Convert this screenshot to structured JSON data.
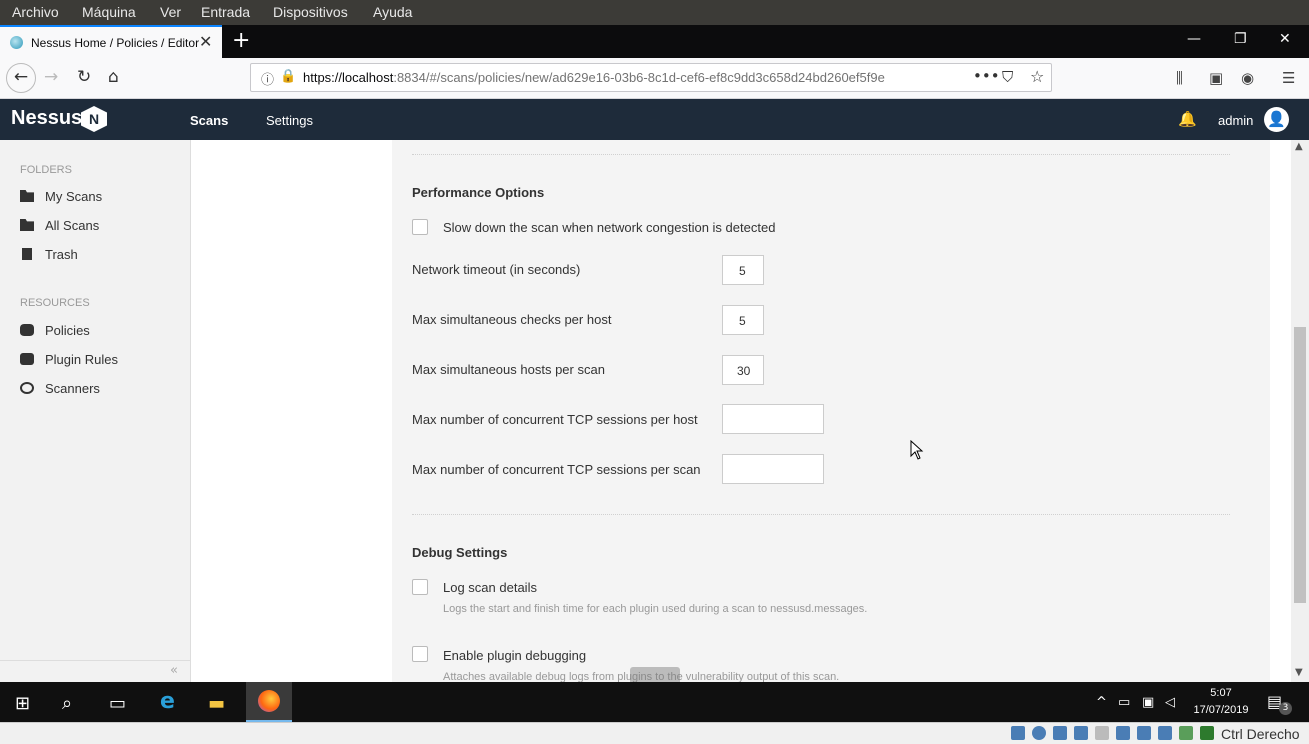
{
  "vb_menu": [
    "Archivo",
    "Máquina",
    "Ver",
    "Entrada",
    "Dispositivos",
    "Ayuda"
  ],
  "browser": {
    "tab_title": "Nessus Home / Policies / Editor",
    "url_host": "https://localhost",
    "url_rest": ":8834/#/scans/policies/new/ad629e16-03b6-8c1d-cef6-ef8c9dd3c658d24bd260ef5f9e"
  },
  "nessus": {
    "logo": "Nessus",
    "logo_badge": "N",
    "tabs": [
      "Scans",
      "Settings"
    ],
    "user": "admin"
  },
  "sidebar": {
    "folders_heading": "FOLDERS",
    "folders": [
      "My Scans",
      "All Scans",
      "Trash"
    ],
    "resources_heading": "RESOURCES",
    "resources": [
      "Policies",
      "Plugin Rules",
      "Scanners"
    ]
  },
  "performance": {
    "title": "Performance Options",
    "slow_down_label": "Slow down the scan when network congestion is detected",
    "fields": [
      {
        "label": "Network timeout (in seconds)",
        "value": "5"
      },
      {
        "label": "Max simultaneous checks per host",
        "value": "5"
      },
      {
        "label": "Max simultaneous hosts per scan",
        "value": "30"
      },
      {
        "label": "Max number of concurrent TCP sessions per host",
        "value": ""
      },
      {
        "label": "Max number of concurrent TCP sessions per scan",
        "value": ""
      }
    ]
  },
  "debug": {
    "title": "Debug Settings",
    "log_label": "Log scan details",
    "log_help": "Logs the start and finish time for each plugin used during a scan to nessusd.messages.",
    "plugin_label": "Enable plugin debugging",
    "plugin_help": "Attaches available debug logs from plugins to the vulnerability output of this scan."
  },
  "taskbar": {
    "time": "5:07",
    "date": "17/07/2019",
    "notifications": "3"
  },
  "vb_status": {
    "host_key": "Ctrl Derecho"
  }
}
